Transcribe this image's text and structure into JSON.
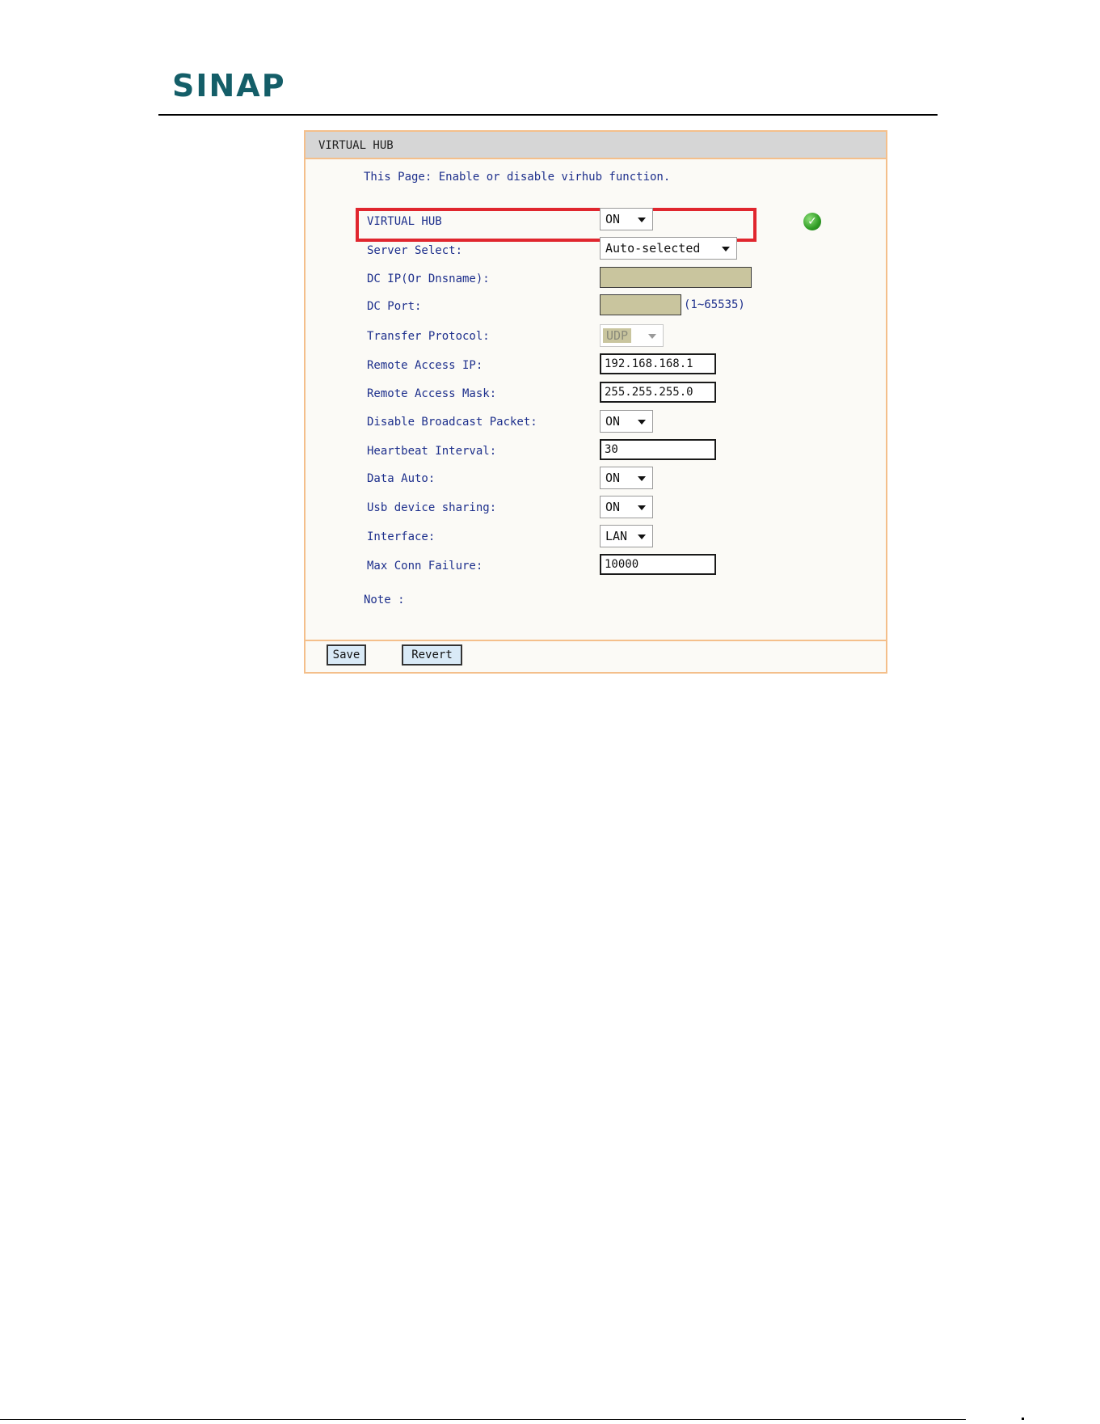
{
  "brand": {
    "logo_text": "SINAP"
  },
  "panel": {
    "title": "VIRTUAL HUB",
    "intro": "This Page: Enable or disable virhub function.",
    "note_label": "Note :"
  },
  "form": {
    "virtual_hub": {
      "label": "VIRTUAL HUB",
      "value": "ON"
    },
    "server_select": {
      "label": "Server Select:",
      "value": "Auto-selected"
    },
    "dc_ip": {
      "label": "DC IP(Or Dnsname):",
      "value": ""
    },
    "dc_port": {
      "label": "DC Port:",
      "value": "",
      "hint": "(1~65535)"
    },
    "transfer_protocol": {
      "label": "Transfer Protocol:",
      "value": "UDP"
    },
    "remote_access_ip": {
      "label": "Remote Access IP:",
      "value": "192.168.168.1"
    },
    "remote_access_mask": {
      "label": "Remote Access Mask:",
      "value": "255.255.255.0"
    },
    "disable_broadcast": {
      "label": "Disable Broadcast Packet:",
      "value": "ON"
    },
    "heartbeat_interval": {
      "label": "Heartbeat Interval:",
      "value": "30"
    },
    "data_auto": {
      "label": "Data Auto:",
      "value": "ON"
    },
    "usb_sharing": {
      "label": "Usb device sharing:",
      "value": "ON"
    },
    "interface": {
      "label": "Interface:",
      "value": "LAN"
    },
    "max_conn_failure": {
      "label": "Max Conn Failure:",
      "value": "10000"
    }
  },
  "buttons": {
    "save": "Save",
    "revert": "Revert"
  },
  "icons": {
    "status": "check-circle-icon"
  },
  "colors": {
    "brand": "#145e68",
    "label_text": "#1d2f8c",
    "panel_border": "#f4bf8b",
    "highlight": "#e0262e",
    "disabled_field": "#c9c59e",
    "button_bg": "#d9eaf7"
  }
}
